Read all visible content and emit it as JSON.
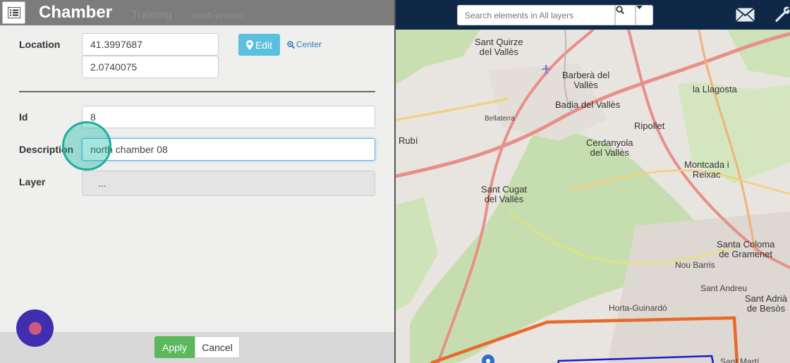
{
  "panel": {
    "title": "Chamber",
    "ghost_tabs": [
      "Training",
      "north-project"
    ],
    "location_label": "Location",
    "latitude": "41.3997687",
    "longitude": "2.0740075",
    "edit_label": "Edit",
    "center_label": "Center",
    "id_label": "Id",
    "id_value": "8",
    "description_label": "Description",
    "description_value": "north chamber 08",
    "layer_label": "Layer",
    "layer_value": "...",
    "apply_label": "Apply",
    "cancel_label": "Cancel"
  },
  "map": {
    "search_placeholder": "Search elements in All layers",
    "places": {
      "sant_quirze": "Sant Quirze\ndel Vallès",
      "barbera": "Barberà del\nVallès",
      "badia": "Badia del Vallès",
      "bellaterra": "Bellaterra",
      "ripollet": "Ripollet",
      "lallagosta": "la Llagosta",
      "rubi": "Rubí",
      "cerdanyola": "Cerdanyola\ndel Vallès",
      "montcada": "Montcada i\nReixac",
      "sant_cugat": "Sant Cugat\ndel Vallès",
      "santa_coloma": "Santa Coloma\nde Gramenet",
      "nou_barris": "Nou Barris",
      "sant_andreu": "Sant Andreu",
      "sant_adria": "Sant Adrià\nde Besòs",
      "horta": "Horta-Guinardó",
      "sant_marti": "Sant Martí"
    }
  },
  "colors": {
    "panel_bg": "#efefee",
    "edit_btn": "#5bc0de",
    "apply_btn": "#5cb85c",
    "map_header": "#0f2847",
    "touch_indicator": "#1fae9e",
    "fab": "#3f2fb0",
    "orange_polygon": "#e8692c",
    "blue_polygon": "#1a1ad0"
  }
}
